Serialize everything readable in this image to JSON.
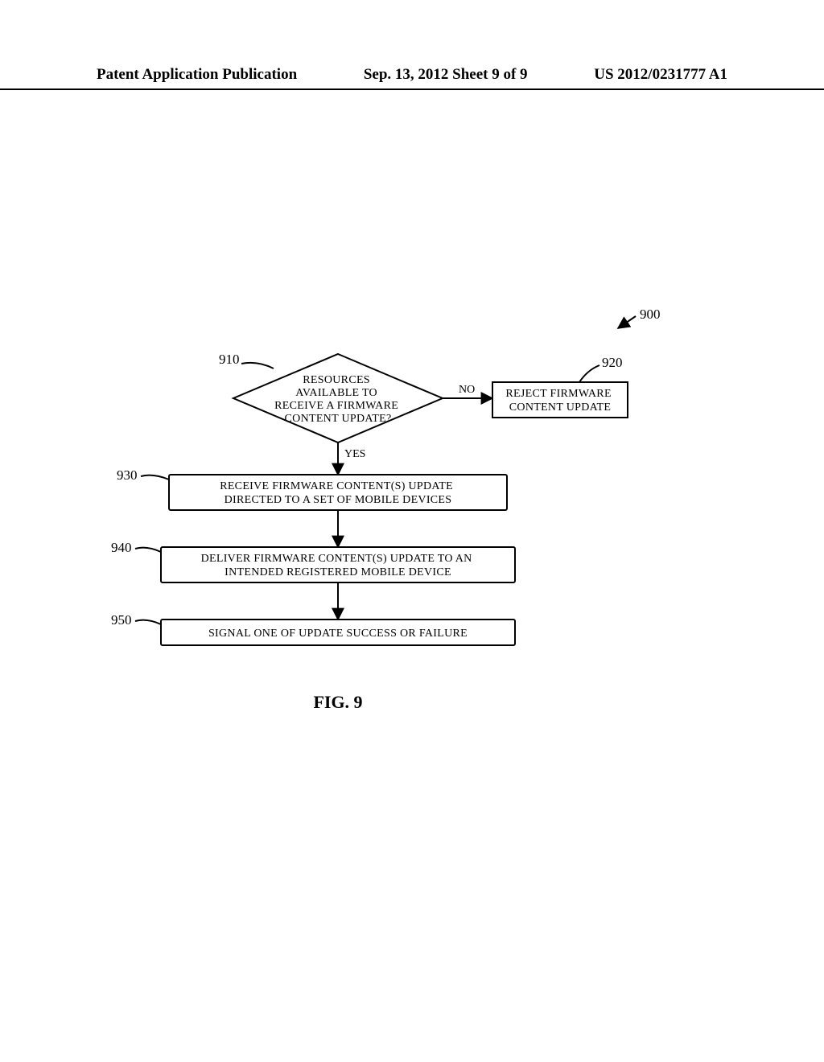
{
  "header": {
    "left": "Patent Application Publication",
    "center": "Sep. 13, 2012  Sheet 9 of 9",
    "right": "US 2012/0231777 A1"
  },
  "diagram": {
    "figure_label": "FIG. 9",
    "overall_ref": "900",
    "steps": {
      "decision": {
        "ref": "910",
        "lines": [
          "RESOURCES",
          "AVAILABLE TO",
          "RECEIVE A FIRMWARE",
          "CONTENT UPDATE?"
        ]
      },
      "reject": {
        "ref": "920",
        "lines": [
          "REJECT FIRMWARE",
          "CONTENT UPDATE"
        ]
      },
      "receive": {
        "ref": "930",
        "lines": [
          "RECEIVE FIRMWARE CONTENT(S) UPDATE",
          "DIRECTED TO A SET OF MOBILE DEVICES"
        ]
      },
      "deliver": {
        "ref": "940",
        "lines": [
          "DELIVER FIRMWARE CONTENT(S) UPDATE TO AN",
          "INTENDED REGISTERED MOBILE DEVICE"
        ]
      },
      "signal": {
        "ref": "950",
        "lines": [
          "SIGNAL ONE OF UPDATE SUCCESS OR FAILURE"
        ]
      }
    },
    "edges": {
      "no": "NO",
      "yes": "YES"
    }
  },
  "chart_data": {
    "type": "flowchart",
    "reference_numeral": "900",
    "figure": "FIG. 9",
    "nodes": [
      {
        "id": "910",
        "kind": "decision",
        "text": "RESOURCES AVAILABLE TO RECEIVE A FIRMWARE CONTENT UPDATE?"
      },
      {
        "id": "920",
        "kind": "process",
        "text": "REJECT FIRMWARE CONTENT UPDATE"
      },
      {
        "id": "930",
        "kind": "process",
        "text": "RECEIVE FIRMWARE CONTENT(S) UPDATE DIRECTED TO A SET OF MOBILE DEVICES"
      },
      {
        "id": "940",
        "kind": "process",
        "text": "DELIVER FIRMWARE CONTENT(S) UPDATE TO AN INTENDED REGISTERED MOBILE DEVICE"
      },
      {
        "id": "950",
        "kind": "process",
        "text": "SIGNAL ONE OF UPDATE SUCCESS OR FAILURE"
      }
    ],
    "edges": [
      {
        "from": "910",
        "to": "920",
        "label": "NO"
      },
      {
        "from": "910",
        "to": "930",
        "label": "YES"
      },
      {
        "from": "930",
        "to": "940",
        "label": ""
      },
      {
        "from": "940",
        "to": "950",
        "label": ""
      }
    ]
  }
}
